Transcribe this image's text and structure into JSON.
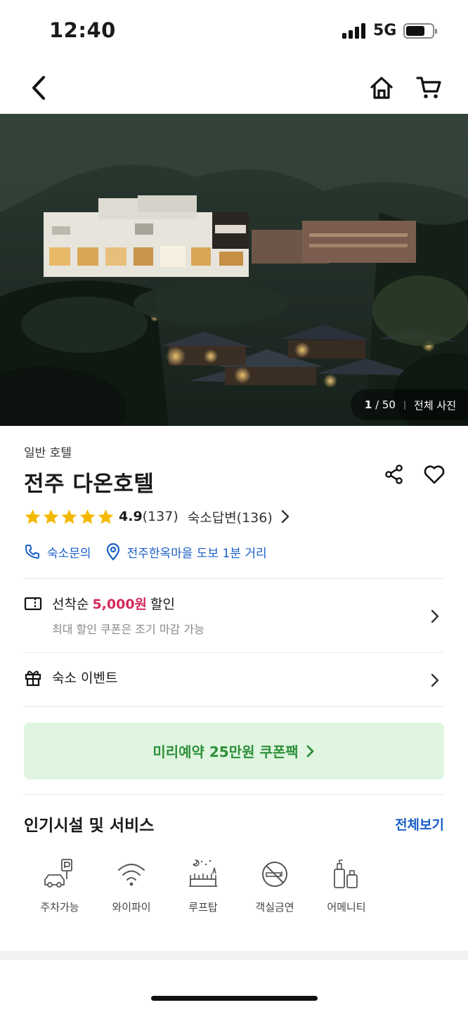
{
  "status_bar": {
    "time": "12:40",
    "network": "5G"
  },
  "hero": {
    "current": "1",
    "total": "50",
    "all_photos_label": "전체 사진"
  },
  "hotel": {
    "category": "일반 호텔",
    "name": "전주 다온호텔",
    "rating": "4.9",
    "rating_stars": 5,
    "review_count": "(137)",
    "reply_label": "숙소답변(136)",
    "inquiry_label": "숙소문의",
    "location_label": "전주한옥마을 도보 1분 거리"
  },
  "coupon": {
    "prefix": "선착순",
    "amount": "5,000원",
    "suffix": "할인",
    "sub": "최대 할인 쿠폰은 조기 마감 가능"
  },
  "event": {
    "label": "숙소 이벤트"
  },
  "promo": {
    "label": "미리예약 25만원 쿠폰팩"
  },
  "facilities_section": {
    "title": "인기시설 및 서비스",
    "see_all": "전체보기",
    "items": [
      {
        "label": "주차가능",
        "icon": "parking-icon"
      },
      {
        "label": "와이파이",
        "icon": "wifi-icon"
      },
      {
        "label": "루프탑",
        "icon": "rooftop-icon"
      },
      {
        "label": "객실금연",
        "icon": "no-smoking-icon"
      },
      {
        "label": "어메니티",
        "icon": "amenity-icon"
      }
    ]
  },
  "colors": {
    "link_blue": "#1a5fc8",
    "coupon_pink": "#d32a5c",
    "promo_green": "#2e8f3b",
    "promo_bg": "#dff5df",
    "star": "#f5b800"
  }
}
